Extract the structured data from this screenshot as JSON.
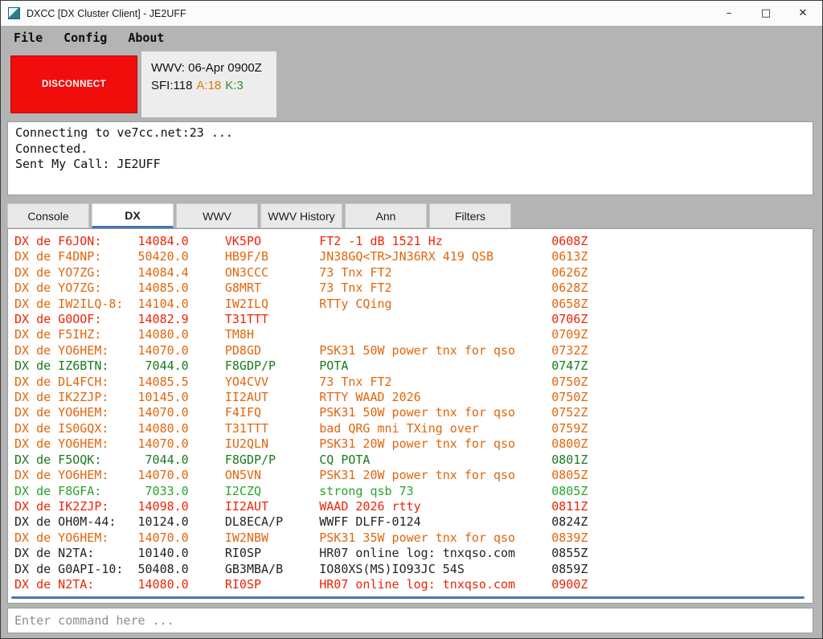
{
  "window": {
    "title": "DXCC [DX Cluster Client] - JE2UFF",
    "controls": {
      "minimize": "–",
      "maximize": "□",
      "close": "✕"
    }
  },
  "menu": {
    "items": [
      {
        "id": "file",
        "label": "File"
      },
      {
        "id": "config",
        "label": "Config"
      },
      {
        "id": "about",
        "label": "About"
      }
    ]
  },
  "toolbar": {
    "disconnect_label": "DISCONNECT",
    "wwv": {
      "line1": "WWV: 06-Apr 0900Z",
      "sfi": "SFI:118",
      "a": "A:18",
      "k": "K:3"
    }
  },
  "console": {
    "lines": [
      "Connecting to ve7cc.net:23 ...",
      "Connected.",
      "Sent My Call: JE2UFF"
    ]
  },
  "tabs": [
    {
      "id": "console",
      "label": "Console",
      "active": false
    },
    {
      "id": "dx",
      "label": "DX",
      "active": true
    },
    {
      "id": "wwv",
      "label": "WWV",
      "active": false
    },
    {
      "id": "wwv-history",
      "label": "WWV History",
      "active": false
    },
    {
      "id": "ann",
      "label": "Ann",
      "active": false
    },
    {
      "id": "filters",
      "label": "Filters",
      "active": false
    }
  ],
  "spots": {
    "prefix": "DX de",
    "rows": [
      {
        "spotter": "F6JON:",
        "freq": "14084.0",
        "call": "VK5PO",
        "comment": "FT2 -1 dB 1521 Hz",
        "time": "0608Z",
        "color": "red"
      },
      {
        "spotter": "F4DNP:",
        "freq": "50420.0",
        "call": "HB9F/B",
        "comment": "JN38GQ<TR>JN36RX 419 QSB",
        "time": "0613Z",
        "color": "orange"
      },
      {
        "spotter": "YO7ZG:",
        "freq": "14084.4",
        "call": "ON3CCC",
        "comment": "73 Tnx FT2",
        "time": "0626Z",
        "color": "orange"
      },
      {
        "spotter": "YO7ZG:",
        "freq": "14085.0",
        "call": "G8MRT",
        "comment": "73 Tnx FT2",
        "time": "0628Z",
        "color": "orange"
      },
      {
        "spotter": "IW2ILQ-8:",
        "freq": "14104.0",
        "call": "IW2ILQ",
        "comment": "RTTy CQing",
        "time": "0658Z",
        "color": "orange"
      },
      {
        "spotter": "G0OOF:",
        "freq": "14082.9",
        "call": "T31TTT",
        "comment": "",
        "time": "0706Z",
        "color": "red"
      },
      {
        "spotter": "F5IHZ:",
        "freq": "14080.0",
        "call": "TM8H",
        "comment": "",
        "time": "0709Z",
        "color": "orange"
      },
      {
        "spotter": "YO6HEM:",
        "freq": "14070.0",
        "call": "PD8GD",
        "comment": "PSK31 50W power tnx for qso",
        "time": "0732Z",
        "color": "orange"
      },
      {
        "spotter": "IZ6BTN:",
        "freq": "7044.0",
        "call": "F8GDP/P",
        "comment": "POTA",
        "time": "0747Z",
        "color": "darkgreen"
      },
      {
        "spotter": "DL4FCH:",
        "freq": "14085.5",
        "call": "YO4CVV",
        "comment": "73 Tnx FT2",
        "time": "0750Z",
        "color": "orange"
      },
      {
        "spotter": "IK2ZJP:",
        "freq": "10145.0",
        "call": "II2AUT",
        "comment": "RTTY WAAD 2026",
        "time": "0750Z",
        "color": "orange"
      },
      {
        "spotter": "YO6HEM:",
        "freq": "14070.0",
        "call": "F4IFQ",
        "comment": "PSK31 50W power tnx for qso",
        "time": "0752Z",
        "color": "orange"
      },
      {
        "spotter": "IS0GQX:",
        "freq": "14080.0",
        "call": "T31TTT",
        "comment": "bad QRG mni TXing over",
        "time": "0759Z",
        "color": "orange"
      },
      {
        "spotter": "YO6HEM:",
        "freq": "14070.0",
        "call": "IU2QLN",
        "comment": "PSK31 20W power tnx for qso",
        "time": "0800Z",
        "color": "orange"
      },
      {
        "spotter": "F5OQK:",
        "freq": "7044.0",
        "call": "F8GDP/P",
        "comment": "CQ POTA",
        "time": "0801Z",
        "color": "darkgreen"
      },
      {
        "spotter": "YO6HEM:",
        "freq": "14070.0",
        "call": "ON5VN",
        "comment": "PSK31 20W power tnx for qso",
        "time": "0805Z",
        "color": "orange"
      },
      {
        "spotter": "F8GFA:",
        "freq": "7033.0",
        "call": "I2CZQ",
        "comment": "strong qsb 73",
        "time": "0805Z",
        "color": "green"
      },
      {
        "spotter": "IK2ZJP:",
        "freq": "14098.0",
        "call": "II2AUT",
        "comment": "WAAD 2026 rtty",
        "time": "0811Z",
        "color": "red"
      },
      {
        "spotter": "OH0M-44:",
        "freq": "10124.0",
        "call": "DL8ECA/P",
        "comment": "WWFF DLFF-0124",
        "time": "0824Z",
        "color": "black"
      },
      {
        "spotter": "YO6HEM:",
        "freq": "14070.0",
        "call": "IW2NBW",
        "comment": "PSK31 35W power tnx for qso",
        "time": "0839Z",
        "color": "orange"
      },
      {
        "spotter": "N2TA:",
        "freq": "10140.0",
        "call": "RI0SP",
        "comment": "HR07 online log: tnxqso.com",
        "time": "0855Z",
        "color": "black"
      },
      {
        "spotter": "G0API-10:",
        "freq": "50408.0",
        "call": "GB3MBA/B",
        "comment": "IO80XS(MS)IO93JC 54S",
        "time": "0859Z",
        "color": "black"
      },
      {
        "spotter": "N2TA:",
        "freq": "14080.0",
        "call": "RI0SP",
        "comment": "HR07 online log: tnxqso.com",
        "time": "0900Z",
        "color": "red"
      }
    ]
  },
  "command_input": {
    "placeholder": "Enter command here ...",
    "value": ""
  },
  "colors": {
    "red": "#ee2405",
    "orange": "#e2660b",
    "darkgreen": "#1a7a1e",
    "green": "#2aa42a",
    "black": "#232323",
    "a_index": "#e07800",
    "k_index": "#2f8f2f",
    "disconnect_bg": "#f20d0d",
    "scrollbar_blue": "#4576b5",
    "tab_active_underline": "#4576b5"
  }
}
